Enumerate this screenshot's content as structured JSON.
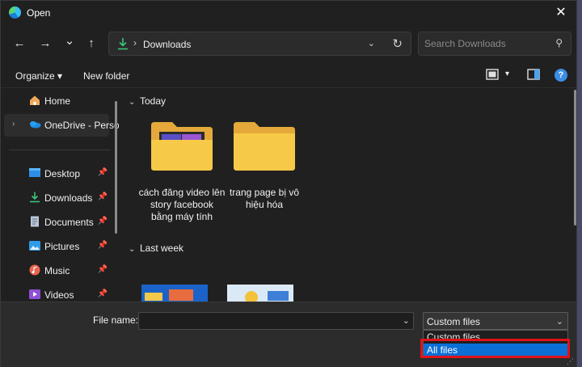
{
  "window": {
    "title": "Open",
    "close_glyph": "✕"
  },
  "nav": {
    "back_glyph": "←",
    "forward_glyph": "→",
    "recent_glyph": "⌄",
    "up_glyph": "↑",
    "address_separator": "›",
    "address_path": "Downloads",
    "address_chevron": "⌄",
    "refresh_glyph": "↻",
    "search_placeholder": "Search Downloads",
    "search_glyph": "⚲"
  },
  "commandbar": {
    "organize_label": "Organize ▾",
    "new_folder_label": "New folder",
    "view_dropdown_glyph": "▾",
    "help_glyph": "?"
  },
  "sidebar": {
    "items": [
      {
        "label": "Home",
        "icon": "home-icon"
      },
      {
        "label": "OneDrive - Perso",
        "icon": "onedrive-icon",
        "expand_glyph": "›"
      },
      {
        "label": "Desktop",
        "icon": "desktop-icon",
        "pin_glyph": "📌"
      },
      {
        "label": "Downloads",
        "icon": "downloads-icon",
        "pin_glyph": "📌"
      },
      {
        "label": "Documents",
        "icon": "documents-icon",
        "pin_glyph": "📌"
      },
      {
        "label": "Pictures",
        "icon": "pictures-icon",
        "pin_glyph": "📌"
      },
      {
        "label": "Music",
        "icon": "music-icon",
        "pin_glyph": "📌"
      },
      {
        "label": "Videos",
        "icon": "videos-icon",
        "pin_glyph": "📌"
      }
    ]
  },
  "content": {
    "groups": [
      {
        "label": "Today",
        "chevron": "⌄"
      },
      {
        "label": "Last week",
        "chevron": "⌄"
      }
    ],
    "today_items": [
      {
        "name": "cách đăng video lên story facebook bằng máy tính",
        "icon": "folder-with-media-icon"
      },
      {
        "name": "trang page bị vô hiệu hóa",
        "icon": "folder-icon"
      }
    ]
  },
  "footer": {
    "file_name_label": "File name:",
    "file_name_value": "",
    "file_name_dropdown": "⌄",
    "file_type_selected": "Custom files",
    "file_type_dropdown": "⌄",
    "file_type_options": [
      "Custom files",
      "All files"
    ],
    "resize_grip": "⋰"
  },
  "colors": {
    "window_bg": "#202020",
    "footer_bg": "#2c2c2c",
    "highlight": "#0b6fd6",
    "annotation_red": "#e0121b",
    "folder_yellow": "#f7c948"
  }
}
